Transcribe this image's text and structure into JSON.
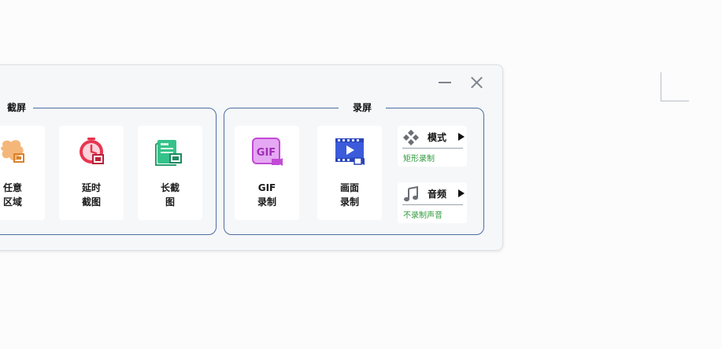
{
  "window": {
    "minimize_icon": "minimize-icon",
    "close_icon": "close-icon"
  },
  "screenshot_group": {
    "title": "截屏",
    "items": [
      {
        "line1": "任意",
        "line2": "区域",
        "icon": "region-crop-icon"
      },
      {
        "line1": "延时",
        "line2": "截图",
        "icon": "timer-screenshot-icon"
      },
      {
        "line1": "长截",
        "line2": "图",
        "icon": "long-screenshot-icon"
      }
    ]
  },
  "record_group": {
    "title": "录屏",
    "items": [
      {
        "line1": "GIF",
        "line2": "录制",
        "icon": "gif-record-icon",
        "icon_text": "GIF"
      },
      {
        "line1": "画面",
        "line2": "录制",
        "icon": "video-record-icon"
      }
    ],
    "options": [
      {
        "label": "模式",
        "value": "矩形录制",
        "icon": "mode-icon"
      },
      {
        "label": "音频",
        "value": "不录制声音",
        "icon": "music-note-icon"
      }
    ]
  },
  "colors": {
    "group_border": "#4d6fa3",
    "option_value": "#2f9a3a",
    "gif_icon": "#c24ad6",
    "video_icon": "#3b5bdb"
  }
}
